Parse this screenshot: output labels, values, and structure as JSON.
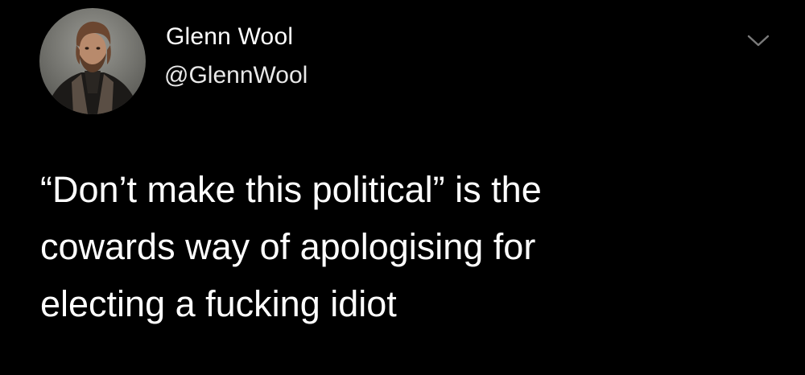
{
  "author": {
    "display_name": "Glenn Wool",
    "handle": "@GlennWool",
    "avatar_icon": "profile-photo"
  },
  "menu": {
    "icon": "chevron-down-icon"
  },
  "tweet": {
    "lines": [
      "“Don’t make this political” is the",
      "cowards way of apologising for",
      "electing a fucking idiot"
    ]
  },
  "colors": {
    "background": "#000000",
    "text": "#ffffff",
    "handle": "#e8e8e8",
    "chevron": "#7a7a7a"
  }
}
